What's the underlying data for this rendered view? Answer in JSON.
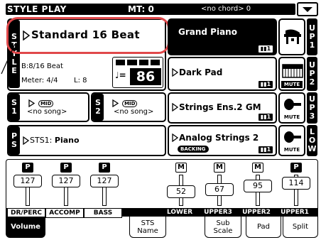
{
  "header": {
    "title": "STYLE PLAY",
    "mt": "MT: 0",
    "chord": "<no chord> 0"
  },
  "style": {
    "side_label": [
      "S",
      "T",
      "Y",
      "L",
      "E"
    ],
    "name": "Standard 16 Beat",
    "beat": "B:8/16 Beat",
    "meter": "Meter: 4/4",
    "length": "L: 8",
    "tempo_symbol": "♩=",
    "tempo": "86"
  },
  "songbooks": [
    {
      "side": [
        "S",
        "1"
      ],
      "icon": "MID",
      "text": "<no song>"
    },
    {
      "side": [
        "S",
        "2"
      ],
      "icon": "MID",
      "text": "<no song>"
    }
  ],
  "performance": {
    "side": [
      "P",
      "S"
    ],
    "text": "STS1: ",
    "bold": "Piano"
  },
  "upper_tracks": [
    {
      "name": "Grand Piano",
      "badge": "1",
      "selected": true,
      "mute": "",
      "side": [
        "U",
        "P",
        "1"
      ]
    },
    {
      "name": "Dark Pad",
      "badge": "1",
      "selected": false,
      "mute": "MUTE",
      "side": [
        "U",
        "P",
        "2"
      ]
    },
    {
      "name": "Strings Ens.2 GM",
      "badge": "1",
      "selected": false,
      "mute": "MUTE",
      "side": [
        "U",
        "P",
        "3"
      ]
    },
    {
      "name": "Analog Strings 2",
      "badge": "1",
      "selected": false,
      "mute": "MUTE",
      "sub": "BACKING",
      "side": [
        "L",
        "O",
        "W"
      ]
    }
  ],
  "mixer": {
    "channels": [
      {
        "mode": "P",
        "value": "127",
        "label": "DR/PERC"
      },
      {
        "mode": "P",
        "value": "127",
        "label": "ACCOMP"
      },
      {
        "mode": "P",
        "value": "127",
        "label": "BASS"
      },
      {
        "mode": "",
        "value": "",
        "label": ""
      },
      {
        "mode": "M",
        "value": "52",
        "label": "LOWER"
      },
      {
        "mode": "M",
        "value": "67",
        "label": "UPPER3"
      },
      {
        "mode": "M",
        "value": "95",
        "label": "UPPER2"
      },
      {
        "mode": "P",
        "value": "114",
        "label": "UPPER1"
      }
    ]
  },
  "tabs": [
    {
      "label": "Volume",
      "active": true
    },
    {
      "label": "STS Name",
      "active": false
    },
    {
      "label": "Sub Scale",
      "active": false
    },
    {
      "label": "Pad",
      "active": false
    },
    {
      "label": "Split",
      "active": false
    }
  ],
  "colors": {
    "highlight": "#e0484a"
  }
}
